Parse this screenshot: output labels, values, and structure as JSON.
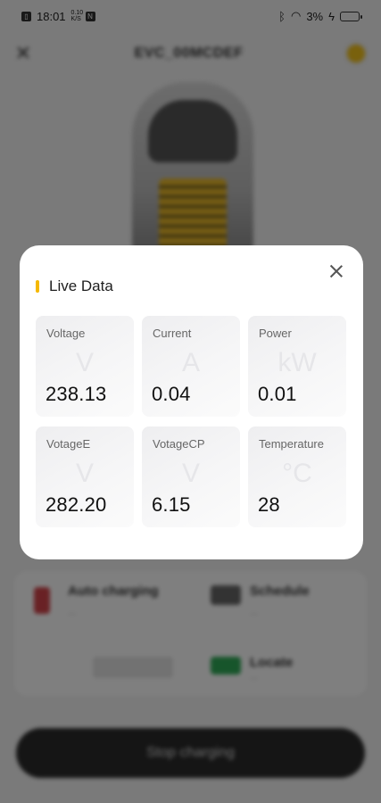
{
  "status_bar": {
    "time": "18:01",
    "net_speed_top": "0.10",
    "net_speed_bottom": "K/S",
    "battery": "3%"
  },
  "background": {
    "device_name": "EVC_00MCDEF",
    "card_items": [
      {
        "label": "Auto charging",
        "sub": "..."
      },
      {
        "label": "Schedule",
        "sub": "..."
      },
      {
        "label": "Locate",
        "sub": "..."
      }
    ],
    "stop_button": "Stop charging"
  },
  "modal": {
    "title": "Live Data",
    "tiles": [
      {
        "label": "Voltage",
        "unit": "V",
        "value": "238.13"
      },
      {
        "label": "Current",
        "unit": "A",
        "value": "0.04"
      },
      {
        "label": "Power",
        "unit": "kW",
        "value": "0.01"
      },
      {
        "label": "VotageE",
        "unit": "V",
        "value": "282.20"
      },
      {
        "label": "VotageCP",
        "unit": "V",
        "value": "6.15"
      },
      {
        "label": "Temperature",
        "unit": "°C",
        "value": "28"
      }
    ]
  },
  "colors": {
    "accent": "#f5b800",
    "overlay": "rgba(0,0,0,0.5)",
    "tile_bg": "#f2f2f4"
  }
}
